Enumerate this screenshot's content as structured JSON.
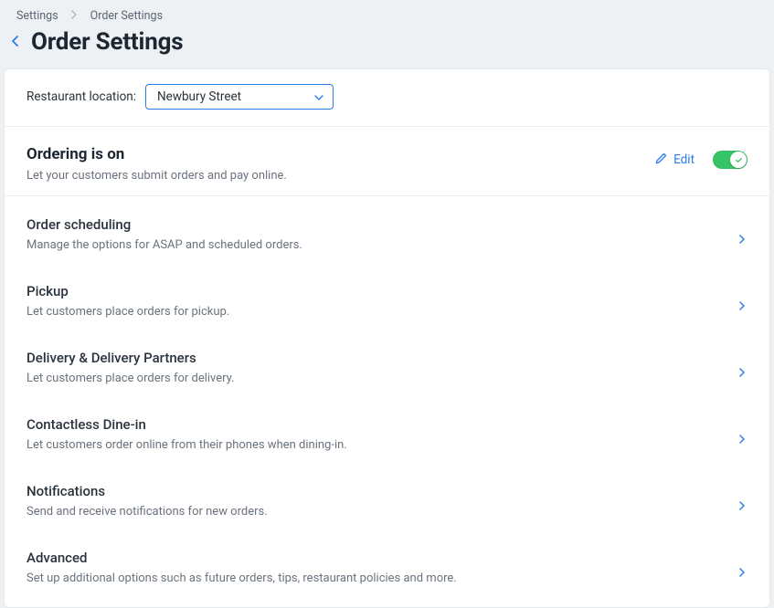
{
  "breadcrumb": {
    "root": "Settings",
    "current": "Order Settings"
  },
  "page_title": "Order Settings",
  "location": {
    "label": "Restaurant location:",
    "selected": "Newbury Street"
  },
  "ordering": {
    "title": "Ordering is on",
    "subtitle": "Let your customers submit orders and pay online.",
    "edit_label": "Edit",
    "toggle_on": true
  },
  "settings": [
    {
      "title": "Order scheduling",
      "subtitle": "Manage the options for ASAP and scheduled orders."
    },
    {
      "title": "Pickup",
      "subtitle": "Let customers place orders for pickup."
    },
    {
      "title": "Delivery & Delivery Partners",
      "subtitle": "Let customers place orders for delivery."
    },
    {
      "title": "Contactless Dine-in",
      "subtitle": "Let customers order online from their phones when dining-in."
    },
    {
      "title": "Notifications",
      "subtitle": "Send and receive notifications for new orders."
    },
    {
      "title": "Advanced",
      "subtitle": "Set up additional options such as future orders, tips, restaurant policies and more."
    }
  ]
}
